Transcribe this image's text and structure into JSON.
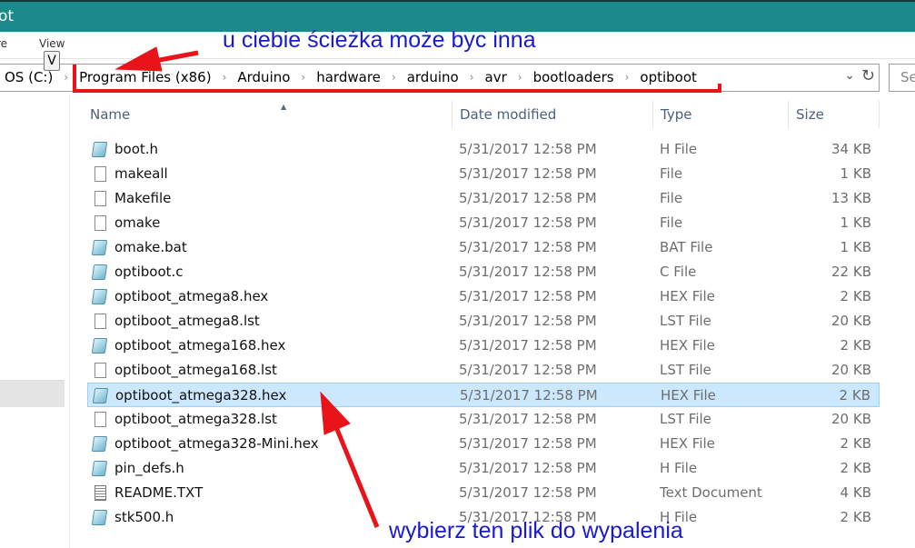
{
  "window": {
    "title_fragment": "ot"
  },
  "ribbon": {
    "share_fragment": "re",
    "view": "View",
    "view_keytip": "V"
  },
  "address": {
    "crumbs": [
      "OS (C:)",
      "Program Files (x86)",
      "Arduino",
      "hardware",
      "arduino",
      "avr",
      "bootloaders",
      "optiboot"
    ]
  },
  "search": {
    "placeholder": "Se"
  },
  "columns": {
    "name": "Name",
    "date": "Date modified",
    "type": "Type",
    "size": "Size"
  },
  "files": [
    {
      "name": "boot.h",
      "date": "5/31/2017 12:58 PM",
      "type": "H File",
      "size": "34 KB",
      "icon": "text-file-icon"
    },
    {
      "name": "makeall",
      "date": "5/31/2017 12:58 PM",
      "type": "File",
      "size": "1 KB",
      "icon": "blank-file-icon"
    },
    {
      "name": "Makefile",
      "date": "5/31/2017 12:58 PM",
      "type": "File",
      "size": "13 KB",
      "icon": "blank-file-icon"
    },
    {
      "name": "omake",
      "date": "5/31/2017 12:58 PM",
      "type": "File",
      "size": "1 KB",
      "icon": "blank-file-icon"
    },
    {
      "name": "omake.bat",
      "date": "5/31/2017 12:58 PM",
      "type": "BAT File",
      "size": "1 KB",
      "icon": "text-file-icon"
    },
    {
      "name": "optiboot.c",
      "date": "5/31/2017 12:58 PM",
      "type": "C File",
      "size": "22 KB",
      "icon": "text-file-icon"
    },
    {
      "name": "optiboot_atmega8.hex",
      "date": "5/31/2017 12:58 PM",
      "type": "HEX File",
      "size": "2 KB",
      "icon": "text-file-icon"
    },
    {
      "name": "optiboot_atmega8.lst",
      "date": "5/31/2017 12:58 PM",
      "type": "LST File",
      "size": "20 KB",
      "icon": "blank-file-icon"
    },
    {
      "name": "optiboot_atmega168.hex",
      "date": "5/31/2017 12:58 PM",
      "type": "HEX File",
      "size": "2 KB",
      "icon": "text-file-icon"
    },
    {
      "name": "optiboot_atmega168.lst",
      "date": "5/31/2017 12:58 PM",
      "type": "LST File",
      "size": "20 KB",
      "icon": "blank-file-icon"
    },
    {
      "name": "optiboot_atmega328.hex",
      "date": "5/31/2017 12:58 PM",
      "type": "HEX File",
      "size": "2 KB",
      "icon": "text-file-icon",
      "selected": true
    },
    {
      "name": "optiboot_atmega328.lst",
      "date": "5/31/2017 12:58 PM",
      "type": "LST File",
      "size": "20 KB",
      "icon": "blank-file-icon"
    },
    {
      "name": "optiboot_atmega328-Mini.hex",
      "date": "5/31/2017 12:58 PM",
      "type": "HEX File",
      "size": "2 KB",
      "icon": "text-file-icon"
    },
    {
      "name": "pin_defs.h",
      "date": "5/31/2017 12:58 PM",
      "type": "H File",
      "size": "2 KB",
      "icon": "text-file-icon"
    },
    {
      "name": "README.TXT",
      "date": "5/31/2017 12:58 PM",
      "type": "Text Document",
      "size": "4 KB",
      "icon": "lined-document-icon"
    },
    {
      "name": "stk500.h",
      "date": "5/31/2017 12:58 PM",
      "type": "H File",
      "size": "2 KB",
      "icon": "text-file-icon"
    }
  ],
  "annotations": {
    "top": "u ciebie ścieżka może byc inna",
    "bottom": "wybierz ten plik do wypalenia",
    "text_color": "#1a1ad0",
    "arrow_color": "#e8141a"
  },
  "colors": {
    "titlebar": "#1b8a8c",
    "selection": "#cce8ff"
  }
}
